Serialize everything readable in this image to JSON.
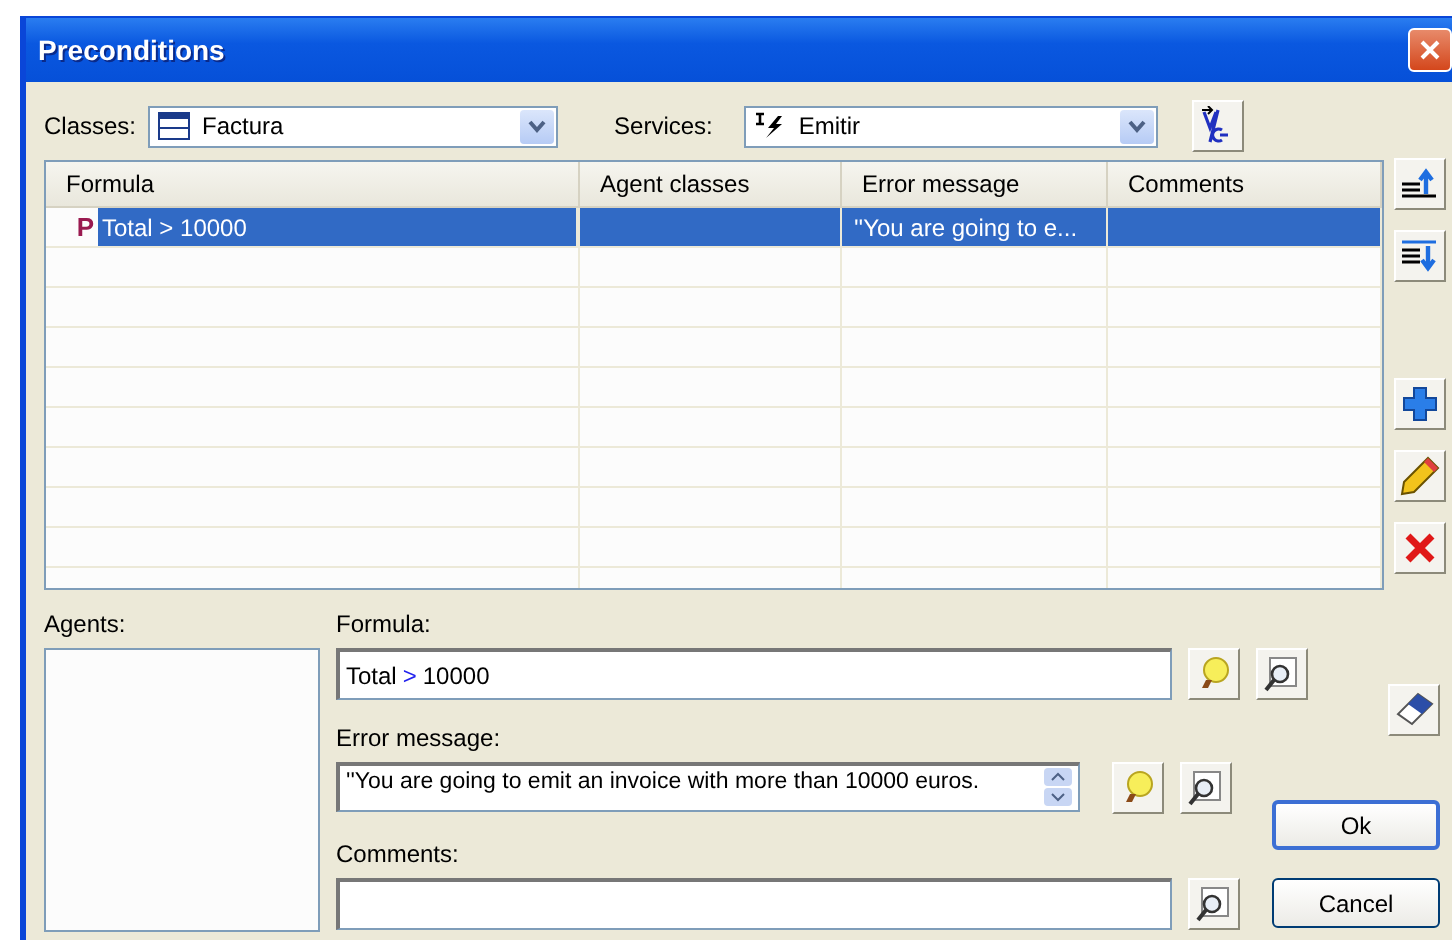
{
  "window": {
    "title": "Preconditions"
  },
  "classes": {
    "label": "Classes:",
    "value": "Factura"
  },
  "services": {
    "label": "Services:",
    "value": "Emitir"
  },
  "table": {
    "columns": [
      "Formula",
      "Agent classes",
      "Error message",
      "Comments"
    ],
    "rows": [
      {
        "marker": "P",
        "formula": "Total > 10000",
        "error_message": "''You are going to e...",
        "selected": true
      }
    ]
  },
  "agents": {
    "label": "Agents:"
  },
  "formula": {
    "label": "Formula:",
    "tokens": [
      {
        "text": "Total",
        "kind": "operand"
      },
      {
        "text": ">",
        "kind": "operator"
      },
      {
        "text": "10000",
        "kind": "operand"
      }
    ]
  },
  "error_message": {
    "label": "Error message:",
    "value": "''You are going to emit an invoice with more than 10000 euros."
  },
  "comments": {
    "label": "Comments:"
  },
  "buttons": [
    {
      "label": "Ok",
      "default": true
    },
    {
      "label": "Cancel",
      "default": false
    }
  ]
}
